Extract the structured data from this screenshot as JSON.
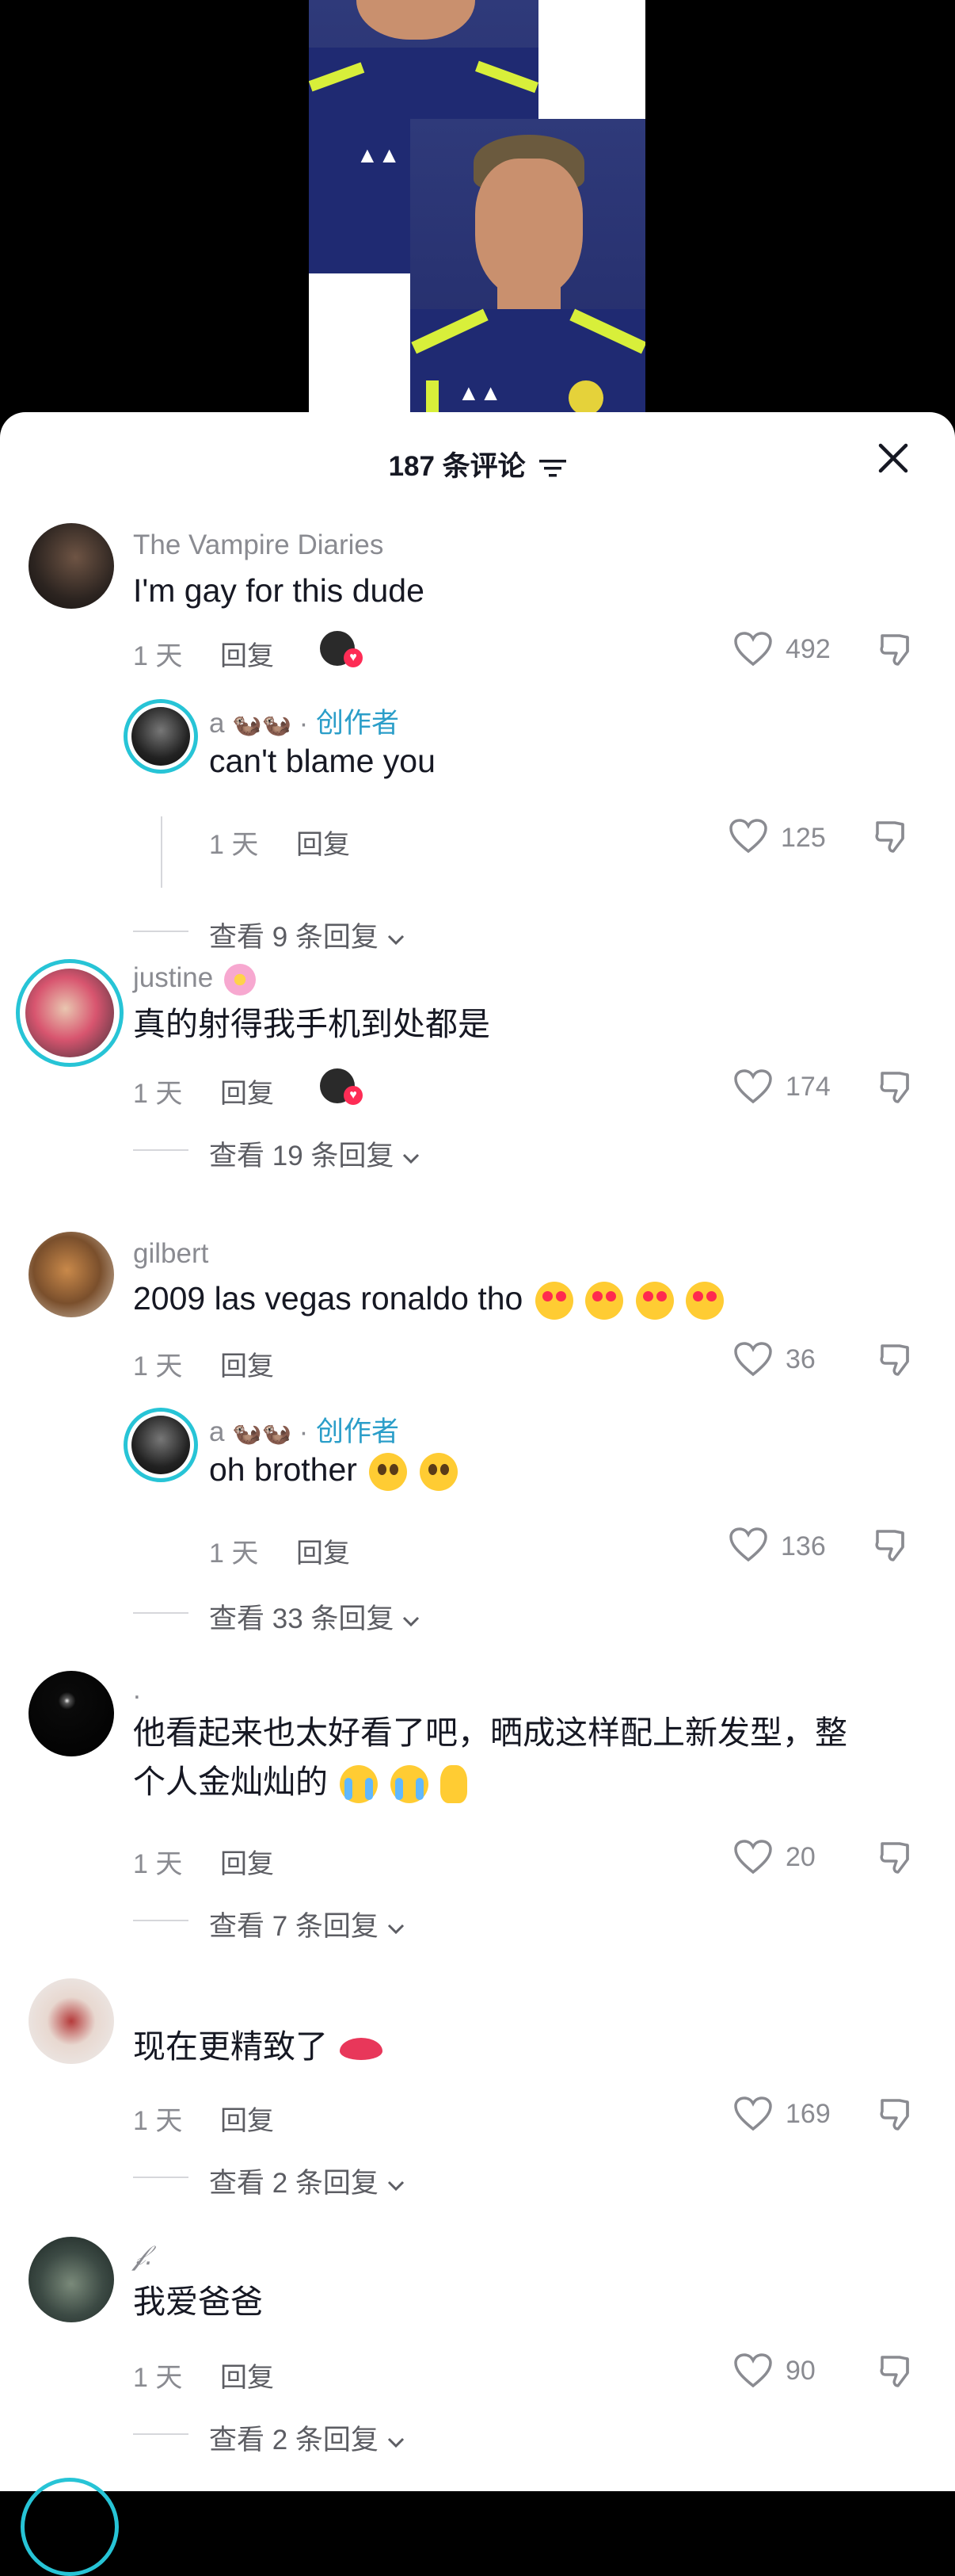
{
  "header": {
    "title": "187 条评论"
  },
  "comments": [
    {
      "username": "The Vampire Diaries",
      "text": "I'm gay for this dude",
      "time": "1 天",
      "reply_label": "回复",
      "likes": "492",
      "replies": [
        {
          "username": "a",
          "creator_label": "创作者",
          "separator": "·",
          "text": "can't blame you",
          "time": "1 天",
          "reply_label": "回复",
          "likes": "125"
        }
      ],
      "view_more": "查看 9 条回复"
    },
    {
      "username": "justine",
      "text": "真的射得我手机到处都是",
      "time": "1 天",
      "reply_label": "回复",
      "likes": "174",
      "view_more": "查看 19 条回复"
    },
    {
      "username": "gilbert",
      "text": "2009 las vegas ronaldo tho",
      "time": "1 天",
      "reply_label": "回复",
      "likes": "36",
      "replies": [
        {
          "username": "a",
          "creator_label": "创作者",
          "separator": "·",
          "text": "oh brother",
          "time": "1 天",
          "reply_label": "回复",
          "likes": "136"
        }
      ],
      "view_more": "查看 33 条回复"
    },
    {
      "username": ".",
      "text_line1": "他看起来也太好看了吧，晒成这样配上新发型，整",
      "text_line2": "个人金灿灿的",
      "time": "1 天",
      "reply_label": "回复",
      "likes": "20",
      "view_more": "查看 7 条回复"
    },
    {
      "username": "",
      "text": "现在更精致了",
      "time": "1 天",
      "reply_label": "回复",
      "likes": "169",
      "view_more": "查看 2 条回复"
    },
    {
      "username": "𝒻.",
      "text": "我爱爸爸",
      "time": "1 天",
      "reply_label": "回复",
      "likes": "90",
      "view_more": "查看 2 条回复"
    }
  ],
  "icons": {
    "close": "close-icon",
    "filter": "filter-icon",
    "heart": "heart-outline-icon",
    "dislike": "thumbs-down-icon",
    "chevron": "chevron-down-icon"
  },
  "colors": {
    "accent": "#2b9ec9",
    "ring": "#27c4d6",
    "like_badge": "#fe2c55"
  }
}
